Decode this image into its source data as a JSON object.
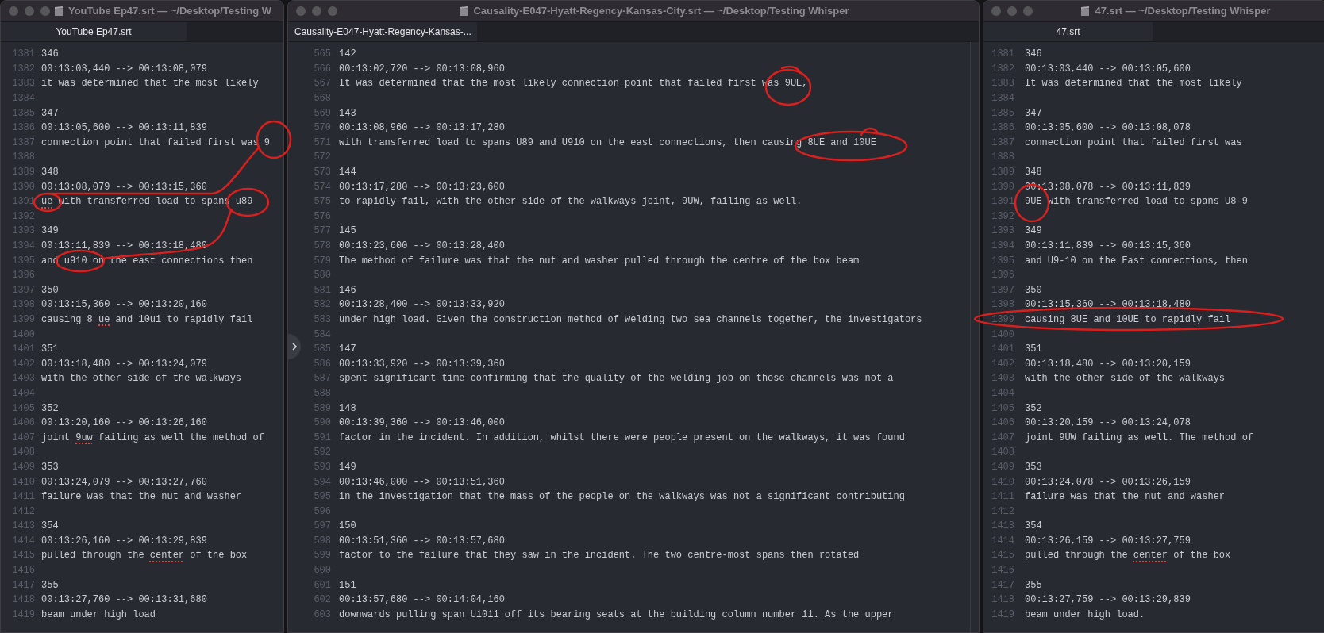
{
  "windows": [
    {
      "title": "YouTube Ep47.srt — ~/Desktop/Testing W",
      "tabs": [
        {
          "label": "YouTube Ep47.srt",
          "selected": true
        }
      ],
      "lines": [
        {
          "n": "1381",
          "text": "346"
        },
        {
          "n": "1382",
          "text": "00:13:03,440 --> 00:13:08,079"
        },
        {
          "n": "1383",
          "text": "it was determined that the most likely"
        },
        {
          "n": "1384"
        },
        {
          "n": "1385",
          "text": "347"
        },
        {
          "n": "1386",
          "text": "00:13:05,600 --> 00:13:11,839"
        },
        {
          "n": "1387",
          "text": "connection point that failed first was 9"
        },
        {
          "n": "1388"
        },
        {
          "n": "1389",
          "text": "348"
        },
        {
          "n": "1390",
          "text": "00:13:08,079 --> 00:13:15,360"
        },
        {
          "n": "1391",
          "segments": [
            {
              "text": "ue",
              "flagged": true
            },
            {
              "text": " with transferred load to spans u89",
              "flagged": false
            }
          ]
        },
        {
          "n": "1392"
        },
        {
          "n": "1393",
          "text": "349"
        },
        {
          "n": "1394",
          "text": "00:13:11,839 --> 00:13:18,480"
        },
        {
          "n": "1395",
          "text": "and u910 on the east connections then"
        },
        {
          "n": "1396"
        },
        {
          "n": "1397",
          "text": "350"
        },
        {
          "n": "1398",
          "text": "00:13:15,360 --> 00:13:20,160"
        },
        {
          "n": "1399",
          "segments": [
            {
              "text": "causing 8 ",
              "flagged": false
            },
            {
              "text": "ue",
              "flagged": true
            },
            {
              "text": " and 10ui to rapidly fail",
              "flagged": false
            }
          ]
        },
        {
          "n": "1400"
        },
        {
          "n": "1401",
          "text": "351"
        },
        {
          "n": "1402",
          "text": "00:13:18,480 --> 00:13:24,079"
        },
        {
          "n": "1403",
          "text": "with the other side of the walkways"
        },
        {
          "n": "1404"
        },
        {
          "n": "1405",
          "text": "352"
        },
        {
          "n": "1406",
          "text": "00:13:20,160 --> 00:13:26,160"
        },
        {
          "n": "1407",
          "segments": [
            {
              "text": "joint ",
              "flagged": false
            },
            {
              "text": "9uw",
              "flagged": true
            },
            {
              "text": " failing as well the method of",
              "flagged": false
            }
          ]
        },
        {
          "n": "1408"
        },
        {
          "n": "1409",
          "text": "353"
        },
        {
          "n": "1410",
          "text": "00:13:24,079 --> 00:13:27,760"
        },
        {
          "n": "1411",
          "text": "failure was that the nut and washer"
        },
        {
          "n": "1412"
        },
        {
          "n": "1413",
          "text": "354"
        },
        {
          "n": "1414",
          "text": "00:13:26,160 --> 00:13:29,839"
        },
        {
          "n": "1415",
          "segments": [
            {
              "text": "pulled through the ",
              "flagged": false
            },
            {
              "text": "center",
              "flagged": true
            },
            {
              "text": " of the box",
              "flagged": false
            }
          ]
        },
        {
          "n": "1416"
        },
        {
          "n": "1417",
          "text": "355"
        },
        {
          "n": "1418",
          "text": "00:13:27,760 --> 00:13:31,680"
        },
        {
          "n": "1419",
          "text": "beam under high load"
        }
      ]
    },
    {
      "title": "Causality-E047-Hyatt-Regency-Kansas-City.srt — ~/Desktop/Testing Whisper",
      "tabs": [
        {
          "label": "Causality-E047-Hyatt-Regency-Kansas-...",
          "selected": true
        }
      ],
      "lines": [
        {
          "n": "565",
          "text": "142"
        },
        {
          "n": "566",
          "text": "00:13:02,720 --> 00:13:08,960"
        },
        {
          "n": "567",
          "text": "It was determined that the most likely connection point that failed first was 9UE,"
        },
        {
          "n": "568"
        },
        {
          "n": "569",
          "text": "143"
        },
        {
          "n": "570",
          "text": "00:13:08,960 --> 00:13:17,280"
        },
        {
          "n": "571",
          "text": "with transferred load to spans U89 and U910 on the east connections, then causing 8UE and 10UE"
        },
        {
          "n": "572"
        },
        {
          "n": "573",
          "text": "144"
        },
        {
          "n": "574",
          "text": "00:13:17,280 --> 00:13:23,600"
        },
        {
          "n": "575",
          "text": "to rapidly fail, with the other side of the walkways joint, 9UW, failing as well."
        },
        {
          "n": "576"
        },
        {
          "n": "577",
          "text": "145"
        },
        {
          "n": "578",
          "text": "00:13:23,600 --> 00:13:28,400"
        },
        {
          "n": "579",
          "text": "The method of failure was that the nut and washer pulled through the centre of the box beam"
        },
        {
          "n": "580"
        },
        {
          "n": "581",
          "text": "146"
        },
        {
          "n": "582",
          "text": "00:13:28,400 --> 00:13:33,920"
        },
        {
          "n": "583",
          "text": "under high load. Given the construction method of welding two sea channels together, the investigators"
        },
        {
          "n": "584"
        },
        {
          "n": "585",
          "text": "147"
        },
        {
          "n": "586",
          "text": "00:13:33,920 --> 00:13:39,360"
        },
        {
          "n": "587",
          "text": "spent significant time confirming that the quality of the welding job on those channels was not a"
        },
        {
          "n": "588"
        },
        {
          "n": "589",
          "text": "148"
        },
        {
          "n": "590",
          "text": "00:13:39,360 --> 00:13:46,000"
        },
        {
          "n": "591",
          "text": "factor in the incident. In addition, whilst there were people present on the walkways, it was found"
        },
        {
          "n": "592"
        },
        {
          "n": "593",
          "text": "149"
        },
        {
          "n": "594",
          "text": "00:13:46,000 --> 00:13:51,360"
        },
        {
          "n": "595",
          "text": "in the investigation that the mass of the people on the walkways was not a significant contributing"
        },
        {
          "n": "596"
        },
        {
          "n": "597",
          "text": "150"
        },
        {
          "n": "598",
          "text": "00:13:51,360 --> 00:13:57,680"
        },
        {
          "n": "599",
          "text": "factor to the failure that they saw in the incident. The two centre-most spans then rotated"
        },
        {
          "n": "600"
        },
        {
          "n": "601",
          "text": "151"
        },
        {
          "n": "602",
          "text": "00:13:57,680 --> 00:14:04,160"
        },
        {
          "n": "603",
          "text": "downwards pulling span U1011 off its bearing seats at the building column number 11. As the upper"
        }
      ]
    },
    {
      "title": "47.srt — ~/Desktop/Testing Whisper",
      "tabs": [
        {
          "label": "47.srt",
          "selected": true
        }
      ],
      "lines": [
        {
          "n": "1381",
          "text": "346"
        },
        {
          "n": "1382",
          "text": "00:13:03,440 --> 00:13:05,600"
        },
        {
          "n": "1383",
          "text": "It was determined that the most likely"
        },
        {
          "n": "1384"
        },
        {
          "n": "1385",
          "text": "347"
        },
        {
          "n": "1386",
          "text": "00:13:05,600 --> 00:13:08,078"
        },
        {
          "n": "1387",
          "text": "connection point that failed first was"
        },
        {
          "n": "1388"
        },
        {
          "n": "1389",
          "text": "348"
        },
        {
          "n": "1390",
          "text": "00:13:08,078 --> 00:13:11,839"
        },
        {
          "n": "1391",
          "text": "9UE with transferred load to spans U8-9"
        },
        {
          "n": "1392"
        },
        {
          "n": "1393",
          "text": "349"
        },
        {
          "n": "1394",
          "text": "00:13:11,839 --> 00:13:15,360"
        },
        {
          "n": "1395",
          "text": "and U9-10 on the East connections, then"
        },
        {
          "n": "1396"
        },
        {
          "n": "1397",
          "text": "350"
        },
        {
          "n": "1398",
          "text": "00:13:15,360 --> 00:13:18,480"
        },
        {
          "n": "1399",
          "text": "causing 8UE and 10UE to rapidly fail"
        },
        {
          "n": "1400"
        },
        {
          "n": "1401",
          "text": "351"
        },
        {
          "n": "1402",
          "text": "00:13:18,480 --> 00:13:20,159"
        },
        {
          "n": "1403",
          "text": "with the other side of the walkways"
        },
        {
          "n": "1404"
        },
        {
          "n": "1405",
          "text": "352"
        },
        {
          "n": "1406",
          "text": "00:13:20,159 --> 00:13:24,078"
        },
        {
          "n": "1407",
          "text": "joint 9UW failing as well. The method of"
        },
        {
          "n": "1408"
        },
        {
          "n": "1409",
          "text": "353"
        },
        {
          "n": "1410",
          "text": "00:13:24,078 --> 00:13:26,159"
        },
        {
          "n": "1411",
          "text": "failure was that the nut and washer"
        },
        {
          "n": "1412"
        },
        {
          "n": "1413",
          "text": "354"
        },
        {
          "n": "1414",
          "text": "00:13:26,159 --> 00:13:27,759"
        },
        {
          "n": "1415",
          "segments": [
            {
              "text": "pulled through the ",
              "flagged": false
            },
            {
              "text": "center",
              "flagged": true
            },
            {
              "text": " of the box",
              "flagged": false
            }
          ]
        },
        {
          "n": "1416"
        },
        {
          "n": "1417",
          "text": "355"
        },
        {
          "n": "1418",
          "text": "00:13:27,759 --> 00:13:29,839"
        },
        {
          "n": "1419",
          "text": "beam under high load."
        }
      ]
    }
  ]
}
